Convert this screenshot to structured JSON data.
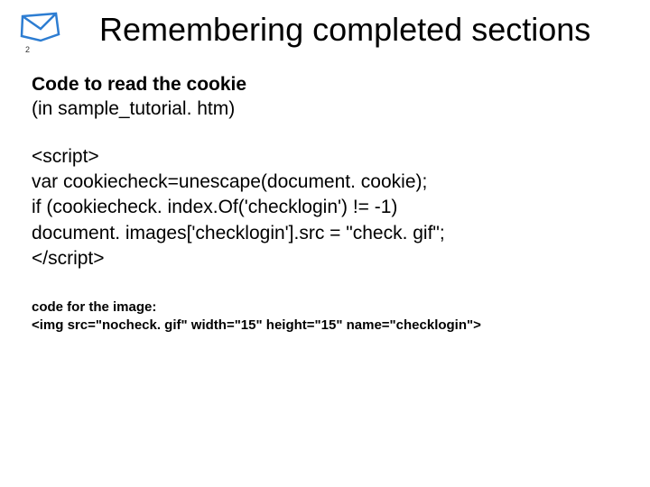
{
  "page_number": "2",
  "title": "Remembering completed sections",
  "subtitle_bold": "Code to read the cookie",
  "subtitle_normal": "(in sample_tutorial. htm)",
  "code_lines": [
    "<script>",
    "var cookiecheck=unescape(document. cookie);",
    "if (cookiecheck. index.Of('checklogin') != -1)",
    "document. images['checklogin'].src = \"check. gif\";",
    "</script>"
  ],
  "footer_bold": "code for the image:",
  "footer_normal": "<img src=\"nocheck. gif\" width=\"15\" height=\"15\" name=\"checklogin\">"
}
